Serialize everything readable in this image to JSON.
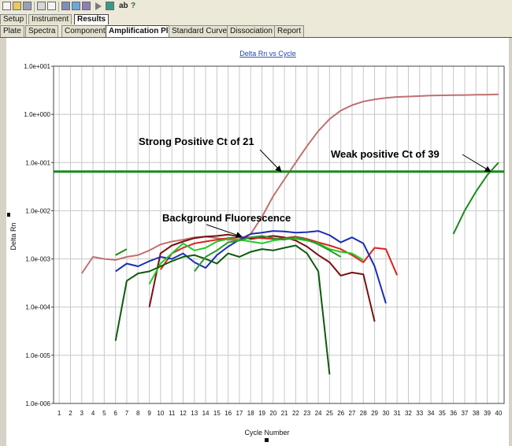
{
  "toolbar": {
    "icons": [
      "new-icon",
      "open-icon",
      "save-icon",
      "print-icon",
      "print-preview-icon",
      "view-icon",
      "analyze-icon",
      "report-icon",
      "run-icon",
      "window-icon",
      "font-icon",
      "help-icon"
    ],
    "font_label": "ab"
  },
  "tabs_top": [
    "Setup",
    "Instrument",
    "Results"
  ],
  "tabs_top_active": "Results",
  "tabs_sub": [
    "Plate",
    "Spectra",
    "Component",
    "Amplification Plot",
    "Standard Curve",
    "Dissociation",
    "Report"
  ],
  "tabs_sub_active": "Amplification Plot",
  "chart_data": {
    "type": "line",
    "title": "Delta Rn vs Cycle",
    "xlabel": "Cycle Number",
    "ylabel": "Delta Rn",
    "x_ticks": [
      1,
      2,
      3,
      4,
      5,
      6,
      7,
      8,
      9,
      10,
      11,
      12,
      13,
      14,
      15,
      16,
      17,
      18,
      19,
      20,
      21,
      22,
      23,
      24,
      25,
      26,
      27,
      28,
      29,
      30,
      31,
      32,
      33,
      34,
      35,
      36,
      37,
      38,
      39,
      40
    ],
    "y_scale": "log",
    "y_ticks": [
      "1.0e+001",
      "1.0e+000",
      "1.0e-001",
      "1.0e-002",
      "1.0e-003",
      "1.0e-004",
      "1.0e-005",
      "1.0e-006"
    ],
    "xlim": [
      0.5,
      40.5
    ],
    "ylim": [
      1e-06,
      10
    ],
    "grid": true,
    "threshold": {
      "value": 0.065,
      "color": "#1a8c1a"
    },
    "series": [
      {
        "color": "#c07070",
        "x": [
          3,
          4,
          5,
          6,
          7,
          8,
          9,
          10,
          11,
          12,
          13,
          14,
          15,
          16,
          17,
          18,
          19,
          20,
          21,
          22,
          23,
          24,
          25,
          26,
          27,
          28,
          29,
          30,
          31,
          32,
          33,
          34,
          35,
          36,
          37,
          38,
          39,
          40
        ],
        "y": [
          0.0005,
          0.0011,
          0.001,
          0.00095,
          0.0011,
          0.0012,
          0.0015,
          0.002,
          0.0023,
          0.0025,
          0.0028,
          0.0029,
          0.0027,
          0.0025,
          0.0024,
          0.0033,
          0.0075,
          0.02,
          0.045,
          0.1,
          0.22,
          0.45,
          0.8,
          1.2,
          1.55,
          1.85,
          2.05,
          2.2,
          2.3,
          2.35,
          2.4,
          2.45,
          2.48,
          2.5,
          2.52,
          2.55,
          2.57,
          2.6
        ]
      },
      {
        "color": "#1a8c1a",
        "x": [
          36,
          37,
          38,
          39,
          40
        ],
        "y": [
          0.0033,
          0.01,
          0.025,
          0.055,
          0.1
        ]
      },
      {
        "color": "#7a1010",
        "x": [
          9,
          10,
          11,
          12,
          13,
          14,
          15,
          16,
          17,
          18,
          19,
          20,
          21,
          22,
          23,
          24,
          25,
          26,
          27,
          28,
          29
        ],
        "y": [
          0.0001,
          0.0013,
          0.0019,
          0.0023,
          0.0027,
          0.0029,
          0.003,
          0.0032,
          0.0029,
          0.0026,
          0.0028,
          0.003,
          0.0028,
          0.0024,
          0.0018,
          0.0012,
          0.00085,
          0.00045,
          0.00052,
          0.00048,
          5e-05
        ]
      },
      {
        "color": "#dd2222",
        "x": [
          10,
          11,
          12,
          13,
          14,
          15,
          16,
          17,
          18,
          19,
          20,
          21,
          22,
          23,
          24,
          25,
          26,
          27,
          28,
          29,
          30,
          31
        ],
        "y": [
          0.0006,
          0.0013,
          0.0017,
          0.0021,
          0.0023,
          0.0025,
          0.0027,
          0.0028,
          0.0028,
          0.0027,
          0.0026,
          0.0027,
          0.0029,
          0.0026,
          0.0022,
          0.0019,
          0.0016,
          0.0012,
          0.00085,
          0.0017,
          0.0016,
          0.00046
        ]
      },
      {
        "color": "#1a2fb0",
        "x": [
          6,
          7,
          8,
          9,
          10,
          11,
          12,
          13,
          14,
          15,
          16,
          17,
          18,
          19,
          20,
          21,
          22,
          23,
          24,
          25,
          26,
          27,
          28,
          29,
          30
        ],
        "y": [
          0.00055,
          0.0008,
          0.0007,
          0.0009,
          0.0011,
          0.001,
          0.0013,
          0.00085,
          0.00065,
          0.0012,
          0.0018,
          0.0025,
          0.0033,
          0.0035,
          0.0038,
          0.0037,
          0.0035,
          0.0036,
          0.0038,
          0.0031,
          0.0022,
          0.0028,
          0.0021,
          0.0007,
          0.00012
        ]
      },
      {
        "color": "#22cc22",
        "x": [
          9,
          10,
          11,
          12,
          13,
          14,
          15,
          16,
          17,
          18,
          19,
          20,
          21,
          22,
          23,
          24,
          25,
          26,
          27,
          28
        ],
        "y": [
          0.0003,
          0.0008,
          0.0013,
          0.0021,
          0.0015,
          0.0017,
          0.0023,
          0.0026,
          0.0025,
          0.0023,
          0.0021,
          0.0024,
          0.0026,
          0.0026,
          0.0024,
          0.0021,
          0.0016,
          0.0014,
          0.0013,
          0.00095
        ]
      },
      {
        "color": "#0e5a0e",
        "x": [
          6,
          7,
          8,
          9,
          10,
          11,
          12,
          13,
          14,
          15,
          16,
          17,
          18,
          19,
          20,
          21,
          22,
          23,
          24,
          25
        ],
        "y": [
          2e-05,
          0.00035,
          0.0005,
          0.00055,
          0.0007,
          0.0009,
          0.0011,
          0.0012,
          0.001,
          0.0008,
          0.0013,
          0.0011,
          0.0014,
          0.0016,
          0.0015,
          0.0017,
          0.0019,
          0.0013,
          0.00055,
          4e-06
        ]
      },
      {
        "color": "#2a9a2a",
        "x": [
          13,
          14,
          15,
          16,
          17,
          18,
          19,
          20,
          21,
          22,
          23,
          24,
          25,
          26
        ],
        "y": [
          0.00055,
          0.0011,
          0.0015,
          0.0022,
          0.0024,
          0.0028,
          0.003,
          0.0027,
          0.0025,
          0.0028,
          0.0025,
          0.002,
          0.0015,
          0.0011
        ]
      },
      {
        "color": "#1a8c1a",
        "x": [
          6,
          7
        ],
        "y": [
          0.0012,
          0.0016
        ]
      }
    ],
    "annotations": [
      {
        "text": "Strong Positive Ct of 21",
        "arrow_to": [
          20.7,
          0.065
        ]
      },
      {
        "text": "Weak positive Ct of 39",
        "arrow_to": [
          39.3,
          0.065
        ]
      },
      {
        "text": "Background  Fluorescence",
        "arrow_to": [
          17.2,
          0.0029
        ]
      }
    ]
  }
}
